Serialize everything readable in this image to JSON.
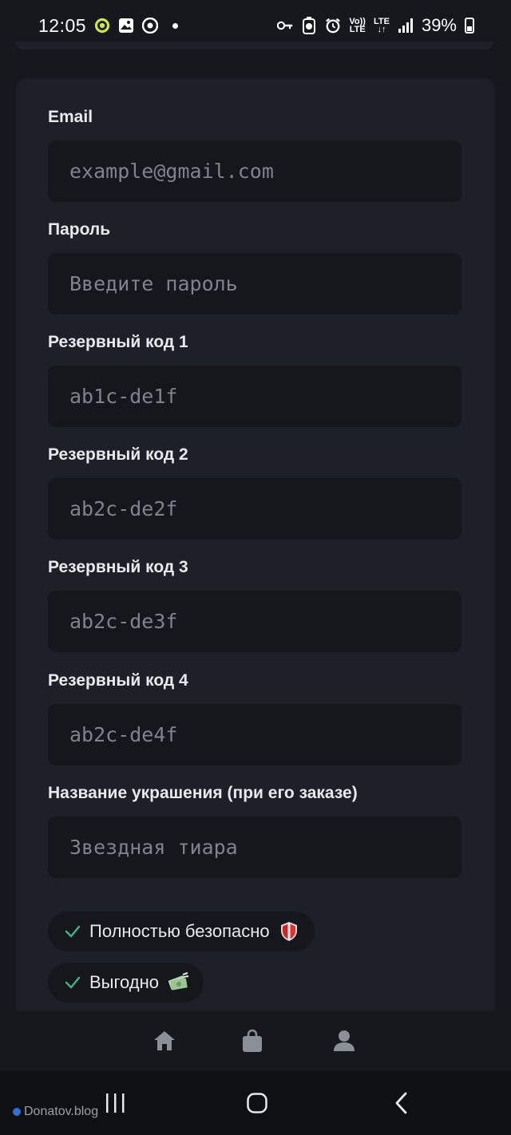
{
  "status_bar": {
    "time": "12:05",
    "battery": "39%",
    "lte_top": "Vo))",
    "lte_bottom": "LTE",
    "lte2_top": "LTE",
    "lte2_bottom": "↓↑",
    "left_icons": [
      "app-notification-icon",
      "gallery-icon",
      "chrome-icon",
      "dot-icon"
    ],
    "right_icons": [
      "vpn-key-icon",
      "battery-saver-icon",
      "alarm-icon",
      "volte-icon",
      "lte-icon",
      "signal-icon",
      "battery-icon"
    ]
  },
  "form": {
    "fields": [
      {
        "label": "Email",
        "placeholder": "example@gmail.com"
      },
      {
        "label": "Пароль",
        "placeholder": "Введите пароль"
      },
      {
        "label": "Резервный код 1",
        "placeholder": "ab1c-de1f"
      },
      {
        "label": "Резервный код 2",
        "placeholder": "ab2c-de2f"
      },
      {
        "label": "Резервный код 3",
        "placeholder": "ab2c-de3f"
      },
      {
        "label": "Резервный код 4",
        "placeholder": "ab2c-de4f"
      },
      {
        "label": "Название украшения (при его заказе)",
        "placeholder": "Звездная тиара"
      }
    ]
  },
  "badges": [
    {
      "text": "Полностью безопасно",
      "icon": "shield-icon"
    },
    {
      "text": "Выгодно",
      "icon": "money-icon"
    }
  ],
  "bottom_nav": [
    "home-icon",
    "shopping-bag-icon",
    "profile-icon"
  ],
  "system_nav": [
    "recents-icon",
    "home-circle-icon",
    "back-icon"
  ],
  "watermark": "Donatov.blog",
  "colors": {
    "background": "#16181e",
    "card": "#1d2027",
    "input": "#15171c",
    "check": "#3fb37f",
    "nav_icon": "#8a8f98"
  }
}
